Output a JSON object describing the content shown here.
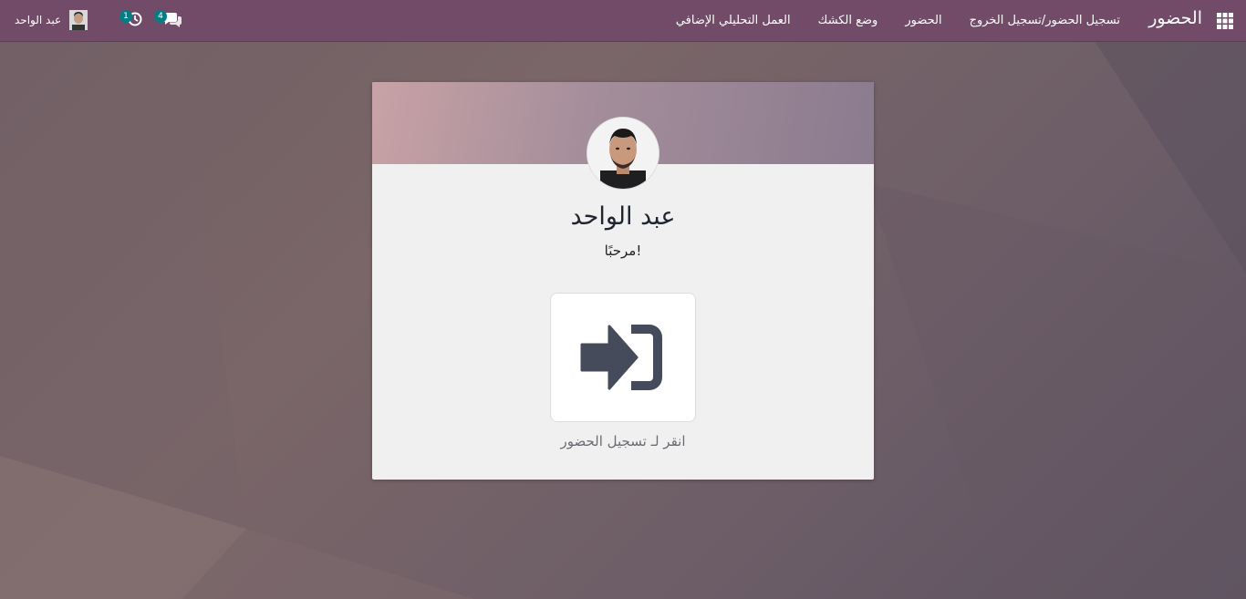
{
  "navbar": {
    "brand": "الحضور",
    "menu": [
      {
        "label": "تسجيل الحضور/تسجيل الخروج"
      },
      {
        "label": "الحضور"
      },
      {
        "label": "وضع الكشك"
      },
      {
        "label": "العمل التحليلي الإضافي"
      }
    ],
    "systray": {
      "messages_count": "4",
      "activities_count": "1",
      "user_name": "عبد الواحد"
    }
  },
  "card": {
    "employee_name": "عبد الواحد",
    "welcome": "مرحبًا!",
    "checkin_caption": "انقر لـ تسجيل الحضور"
  },
  "colors": {
    "navbar": "#714B67",
    "badge": "#017e84",
    "icon": "#454b5a"
  },
  "icons": {
    "apps": "apps-grid-icon",
    "messages": "chat-bubbles-icon",
    "activities": "clock-icon",
    "checkin": "sign-in-icon"
  }
}
